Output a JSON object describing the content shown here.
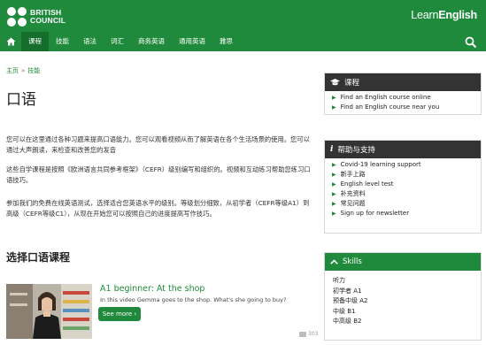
{
  "header": {
    "logo_line1": "BRITISH",
    "logo_line2": "COUNCIL",
    "brand_part1": "Learn",
    "brand_part2": "English",
    "accent_color": "#1f8a3b"
  },
  "nav": {
    "home_icon": "home-icon",
    "items": [
      {
        "label": "课程",
        "active": true
      },
      {
        "label": "技能",
        "active": false
      },
      {
        "label": "语法",
        "active": false
      },
      {
        "label": "词汇",
        "active": false
      },
      {
        "label": "商务英语",
        "active": false
      },
      {
        "label": "通用英语",
        "active": false
      },
      {
        "label": "雅思",
        "active": false
      }
    ],
    "search_icon": "search-icon"
  },
  "breadcrumb": {
    "home": "主页",
    "separator": "»",
    "current": "技能"
  },
  "main": {
    "title": "口语",
    "paragraphs": [
      "您可以在这里通过各种习题来提高口语能力。您可以观看视频从而了解英语在各个生活场景的使用。您可以通过大声朗读，来检查和改善您的发音",
      "这些自学课程是按照《欧洲语言共同参考框架》（CEFR）级别编写和组织的。视频和互动练习帮助您练习口语技巧。",
      "参加我们的免费在线英语测试，选择适合您英语水平的级别。等级划分细致，从初学者（CEFR等级A1）到高级（CEFR等级C1），从现在开始您可以按照自己的进度提高写作技巧。"
    ],
    "section_title": "选择口语课程"
  },
  "card": {
    "title": "A1 beginner: At the shop",
    "description": "In this video Gemma goes to the shop. What's she going to buy?",
    "button": "See more ›",
    "views": "303"
  },
  "sidebar": {
    "courses": {
      "title": "课程",
      "items": [
        "Find an English course online",
        "Find an English course near you"
      ]
    },
    "help": {
      "title": "帮助与支持",
      "items": [
        "Covid-19 learning support",
        "新手上路",
        "English level test",
        "补充资料",
        "常见问题",
        "Sign up for newsletter"
      ]
    },
    "skills": {
      "title": "Skills",
      "items": [
        "听力",
        "初学者 A1",
        "预备中级 A2",
        "中级 B1",
        "中高级 B2"
      ]
    }
  }
}
